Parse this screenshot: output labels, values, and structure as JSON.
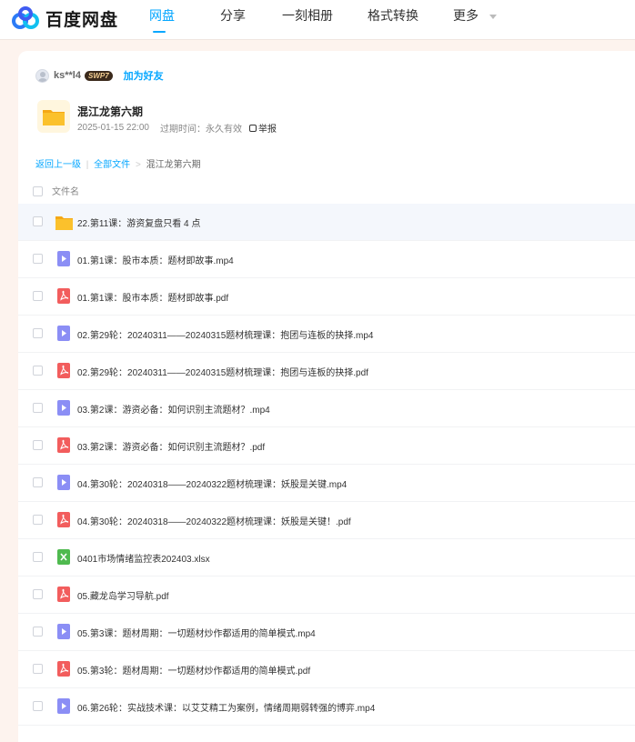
{
  "brand": {
    "name": "百度网盘"
  },
  "nav": [
    {
      "label": "网盘",
      "active": true
    },
    {
      "label": "分享",
      "active": false
    },
    {
      "label": "一刻相册",
      "active": false
    },
    {
      "label": "格式转换",
      "active": false
    },
    {
      "label": "更多",
      "active": false,
      "dropdown": true
    }
  ],
  "sharer": {
    "username": "ks**l4",
    "badge": "SWP7",
    "add_friend": "加为好友"
  },
  "share": {
    "title": "混江龙第六期",
    "date": "2025-01-15 22:00",
    "expiry": "过期时间：永久有效",
    "report": "举报"
  },
  "breadcrumb": {
    "back": "返回上一级",
    "all_files": "全部文件",
    "current": "混江龙第六期"
  },
  "list": {
    "column_name": "文件名",
    "files": [
      {
        "type": "folder",
        "name": "22.第11课：游资复盘只看 4 点"
      },
      {
        "type": "video",
        "name": "01.第1课：股市本质：题材即故事.mp4"
      },
      {
        "type": "pdf",
        "name": "01.第1课：股市本质：题材即故事.pdf"
      },
      {
        "type": "video",
        "name": "02.第29轮：20240311——20240315题材梳理课：抱团与连板的抉择.mp4"
      },
      {
        "type": "pdf",
        "name": "02.第29轮：20240311——20240315题材梳理课：抱团与连板的抉择.pdf"
      },
      {
        "type": "video",
        "name": "03.第2课：游资必备：如何识别主流题材？.mp4"
      },
      {
        "type": "pdf",
        "name": "03.第2课：游资必备：如何识别主流题材？.pdf"
      },
      {
        "type": "video",
        "name": "04.第30轮：20240318——20240322题材梳理课：妖股是关键.mp4"
      },
      {
        "type": "pdf",
        "name": "04.第30轮：20240318——20240322题材梳理课：妖股是关键！.pdf"
      },
      {
        "type": "xls",
        "name": "0401市场情绪监控表202403.xlsx"
      },
      {
        "type": "pdf",
        "name": "05.藏龙岛学习导航.pdf"
      },
      {
        "type": "video",
        "name": "05.第3课：题材周期：一切题材炒作都适用的简单模式.mp4"
      },
      {
        "type": "pdf",
        "name": "05.第3轮：题材周期：一切题材炒作都适用的简单模式.pdf"
      },
      {
        "type": "video",
        "name": "06.第26轮：实战技术课：以艾艾精工为案例，情绪周期弱转强的博弈.mp4"
      }
    ]
  },
  "colors": {
    "accent": "#06a7ff",
    "video": "#8b8ef5",
    "pdf": "#f25d5d",
    "xls": "#4fba4f",
    "folder": "#f7b928"
  }
}
